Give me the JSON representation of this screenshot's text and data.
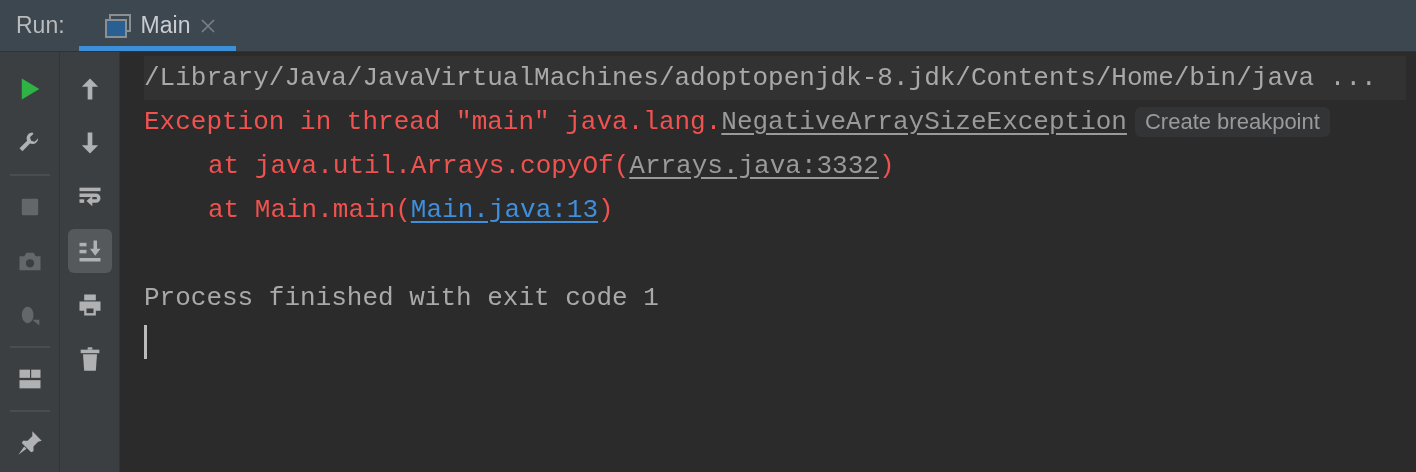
{
  "header": {
    "label": "Run:",
    "tabs": [
      {
        "label": "Main",
        "selected": true,
        "closable": true
      }
    ]
  },
  "left_toolbar": [
    {
      "disabled": false
    },
    {
      "disabled": false
    },
    {
      "disabled": true
    },
    {
      "disabled": true
    },
    {
      "disabled": true
    },
    {
      "disabled": false
    },
    {
      "disabled": false
    }
  ],
  "right_toolbar": [
    {
      "selected": false
    },
    {
      "selected": false
    },
    {
      "selected": false
    },
    {
      "selected": true
    },
    {
      "selected": false
    },
    {
      "selected": false
    }
  ],
  "console": {
    "lines": [
      {
        "kind": "command",
        "segments": [
          {
            "kind": "plain",
            "text": "/Library/Java/JavaVirtualMachines/adoptopenjdk-8.jdk/Contents/Home/bin/java ..."
          }
        ]
      },
      {
        "kind": "output",
        "segments": [
          {
            "kind": "error",
            "text": "Exception in thread \"main\" java.lang."
          },
          {
            "kind": "class_link",
            "text": "NegativeArraySizeException"
          },
          {
            "kind": "chip",
            "text": "Create breakpoint"
          }
        ]
      },
      {
        "kind": "output",
        "indent": true,
        "segments": [
          {
            "kind": "error",
            "text": "at java.util.Arrays.copyOf("
          },
          {
            "kind": "class_link",
            "text": "Arrays.java:3332"
          },
          {
            "kind": "error",
            "text": ")"
          }
        ]
      },
      {
        "kind": "output",
        "indent": true,
        "segments": [
          {
            "kind": "error",
            "text": "at Main.main("
          },
          {
            "kind": "source_link",
            "text": "Main.java:13"
          },
          {
            "kind": "error",
            "text": ")"
          }
        ]
      },
      {
        "kind": "blank"
      },
      {
        "kind": "output",
        "segments": [
          {
            "kind": "plain",
            "text": "Process finished with exit code 1"
          }
        ]
      },
      {
        "kind": "cursor"
      }
    ]
  }
}
